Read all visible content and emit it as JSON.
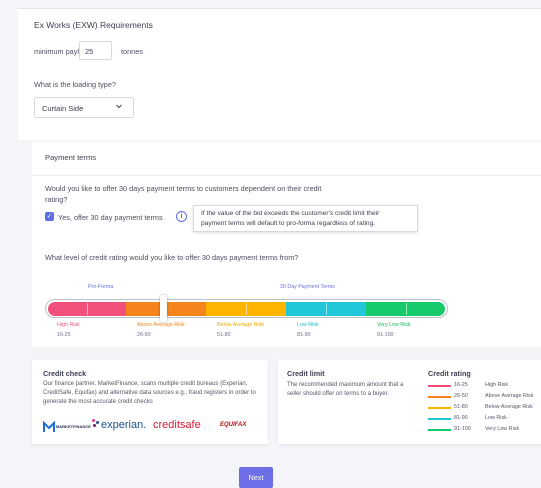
{
  "exw": {
    "title": "Ex Works (EXW) Requirements",
    "payload_label": "minimum payload",
    "payload_value": "25",
    "payload_unit": "tonnes",
    "loading_question": "What is the loading type?",
    "loading_selected": "Curtain Side"
  },
  "payment": {
    "title": "Payment terms",
    "question_line1": "Would you like to offer 30 days payment terms to customers dependent on their credit",
    "question_line2": "rating?",
    "checkbox_label": "Yes, offer 30 day payment terms",
    "checkbox_checked": true,
    "tooltip_line1": "If the value of the bid exceeds the customer's credit limit their",
    "tooltip_line2": "payment terms will default to pro-forma regardless of rating.",
    "slider_question": "What level of credit rating would you like to offer 30 days payment terms from?",
    "left_zone_label": "Pro-Forma",
    "right_zone_label": "30 Day Payment Terms",
    "selected_threshold": 51,
    "ranges": [
      {
        "title": "High Risk",
        "range": "16-25",
        "color": "#f0507a"
      },
      {
        "title": "Above Average Risk",
        "range": "26-50",
        "color": "#f6841d"
      },
      {
        "title": "Below Average Risk",
        "range": "51-80",
        "color": "#ffb400"
      },
      {
        "title": "Low Risk",
        "range": "81-90",
        "color": "#21c7d9"
      },
      {
        "title": "Very Low Risk",
        "range": "91-100",
        "color": "#16c96b"
      }
    ]
  },
  "credit_check": {
    "title": "Credit check",
    "body": "Our finance partner, MarketFinance, scans multiple credit bureaus (Experian, CreditSafe, Equifax) and alternative data sources e.g., fraud registers in order to generate the most accurate credit checks",
    "logos": [
      "MARKETFINANCE",
      "experian.",
      "creditsafe",
      "EQUIFAX"
    ]
  },
  "credit_limit": {
    "title": "Credit limit",
    "body": "The recommended maximum amount that a seller should offer on terms to a buyer."
  },
  "credit_rating": {
    "title": "Credit rating",
    "items": [
      {
        "range": "16-25",
        "name": "High Risk",
        "color": "#f0507a"
      },
      {
        "range": "26-50",
        "name": "Above Average Risk",
        "color": "#f6841d"
      },
      {
        "range": "51-80",
        "name": "Below Average Risk",
        "color": "#ffb400"
      },
      {
        "range": "81-90",
        "name": "Low Risk",
        "color": "#21c7d9"
      },
      {
        "range": "91-100",
        "name": "Very Low Risk",
        "color": "#16c96b"
      }
    ]
  },
  "actions": {
    "next_label": "Next"
  }
}
